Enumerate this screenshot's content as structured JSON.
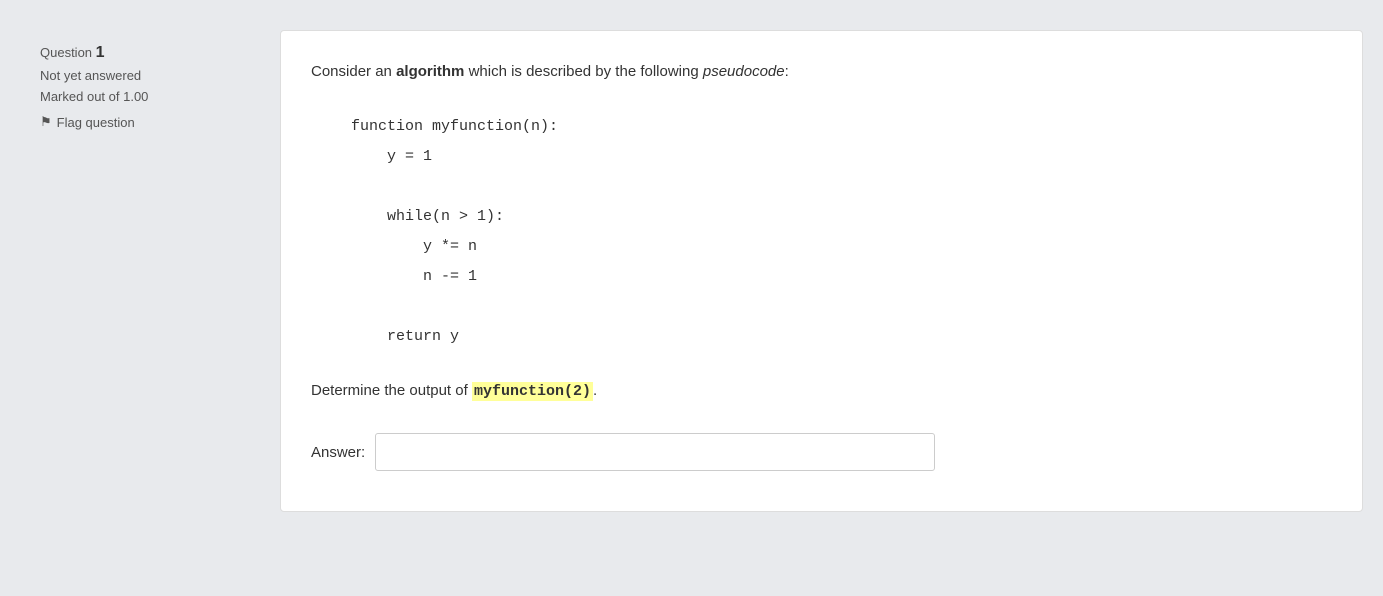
{
  "sidebar": {
    "question_prefix": "Question",
    "question_number": "1",
    "status_label": "Not yet answered",
    "marked_label": "Marked out of 1.00",
    "flag_label": "Flag question",
    "flag_icon": "⚑"
  },
  "main": {
    "question_intro_before_algo": "Consider an ",
    "question_algo_word": "algorithm",
    "question_intro_after_algo": " which is described by the following ",
    "question_pseudo_word": "pseudocode",
    "question_colon": ":",
    "code_lines": [
      "function myfunction(n):",
      "    y = 1",
      "",
      "    while(n > 1):",
      "        y *= n",
      "        n -= 1",
      "",
      "    return y"
    ],
    "determine_before": "Determine the output of ",
    "determine_code": "myfunction(2)",
    "determine_after": ".",
    "answer_label": "Answer:",
    "answer_placeholder": ""
  }
}
